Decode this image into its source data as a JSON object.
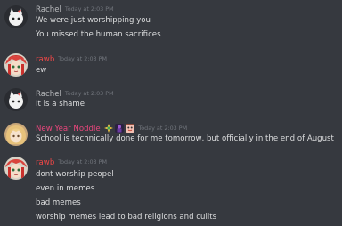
{
  "colors": {
    "background": "#36393f",
    "rachel_name": "#b9bbbe",
    "rawb_name": "#f04747",
    "noodle_name": "#e9467c",
    "timestamp": "#72767d",
    "text": "#dcddde"
  },
  "messages": [
    {
      "author": "Rachel",
      "timestamp": "Today at 2:03 PM",
      "avatar": "kitty-avatar",
      "lines": [
        "We were just worshipping you",
        "You missed the human sacrifices"
      ]
    },
    {
      "author": "rawb",
      "timestamp": "Today at 2:03 PM",
      "avatar": "red-anime-avatar",
      "lines": [
        "ew"
      ]
    },
    {
      "author": "Rachel",
      "timestamp": "Today at 2:03 PM",
      "avatar": "kitty-avatar",
      "lines": [
        "It is a shame"
      ]
    },
    {
      "author": "New Year Noddle",
      "timestamp": "Today at 2:03 PM",
      "avatar": "blonde-anime-avatar",
      "badges": [
        "sparkle-badge-icon",
        "purple-figure-badge-icon",
        "face-badge-icon"
      ],
      "lines": [
        "School is technically done for me tomorrow, but officially in the end of August"
      ]
    },
    {
      "author": "rawb",
      "timestamp": "Today at 2:03 PM",
      "avatar": "red-anime-avatar",
      "lines": [
        "dont worship peopel",
        "even in memes",
        "bad memes",
        "worship memes lead to bad religions and cullts"
      ]
    }
  ]
}
